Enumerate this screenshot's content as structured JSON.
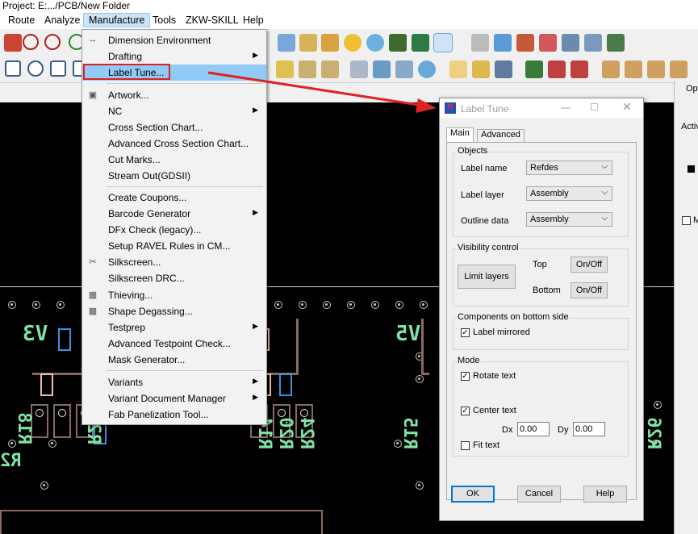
{
  "app": {
    "title": "Project: E:.../PCB/New Folder",
    "menubar": [
      "Route",
      "Analyze",
      "Manufacture",
      "Tools",
      "ZKW-SKILL",
      "Help"
    ],
    "active_menu": "Manufacture"
  },
  "manufacture_menu": {
    "items": [
      {
        "label": "Dimension Environment",
        "icon": "dimension-icon",
        "submenu": false
      },
      {
        "label": "Drafting",
        "icon": "",
        "submenu": true
      },
      {
        "label": "Label Tune...",
        "icon": "",
        "submenu": false,
        "highlighted": true
      },
      {
        "label": "Artwork...",
        "icon": "artwork-icon",
        "submenu": false
      },
      {
        "label": "NC",
        "icon": "",
        "submenu": true
      },
      {
        "label": "Cross Section Chart...",
        "icon": "",
        "submenu": false
      },
      {
        "label": "Advanced Cross Section Chart...",
        "icon": "",
        "submenu": false
      },
      {
        "label": "Cut Marks...",
        "icon": "",
        "submenu": false
      },
      {
        "label": "Stream Out(GDSII)",
        "icon": "",
        "submenu": false
      },
      {
        "label": "Create Coupons...",
        "icon": "",
        "submenu": false
      },
      {
        "label": "Barcode Generator",
        "icon": "",
        "submenu": true
      },
      {
        "label": "DFx Check (legacy)...",
        "icon": "",
        "submenu": false
      },
      {
        "label": "Setup RAVEL Rules in CM...",
        "icon": "",
        "submenu": false
      },
      {
        "label": "Silkscreen...",
        "icon": "silkscreen-icon",
        "submenu": false
      },
      {
        "label": "Silkscreen DRC...",
        "icon": "",
        "submenu": false
      },
      {
        "label": "Thieving...",
        "icon": "thieving-icon",
        "submenu": false
      },
      {
        "label": "Shape Degassing...",
        "icon": "degassing-icon",
        "submenu": false
      },
      {
        "label": "Testprep",
        "icon": "",
        "submenu": true
      },
      {
        "label": "Advanced Testpoint Check...",
        "icon": "",
        "submenu": false
      },
      {
        "label": "Mask Generator...",
        "icon": "",
        "submenu": false
      },
      {
        "label": "Variants",
        "icon": "",
        "submenu": true
      },
      {
        "label": "Variant Document Manager",
        "icon": "",
        "submenu": true
      },
      {
        "label": "Fab Panelization Tool...",
        "icon": "",
        "submenu": false
      }
    ]
  },
  "dialog": {
    "title": "Label Tune",
    "tabs": [
      "Main",
      "Advanced"
    ],
    "objects": {
      "group": "Objects",
      "label_name_label": "Label name",
      "label_name_value": "Refdes",
      "label_layer_label": "Label layer",
      "label_layer_value": "Assembly",
      "outline_data_label": "Outline data",
      "outline_data_value": "Assembly"
    },
    "visibility": {
      "group": "Visibility control",
      "limit_layers": "Limit layers",
      "top_label": "Top",
      "top_button": "On/Off",
      "bottom_label": "Bottom",
      "bottom_button": "On/Off"
    },
    "bottom_side": {
      "group": "Components on bottom side",
      "label_mirrored": "Label mirrored",
      "label_mirrored_checked": true
    },
    "mode": {
      "group": "Mode",
      "rotate_text": "Rotate text",
      "rotate_text_checked": true,
      "center_text": "Center text",
      "center_text_checked": true,
      "dx_label": "Dx",
      "dx_value": "0.00",
      "dy_label": "Dy",
      "dy_value": "0.00",
      "fit_text": "Fit text",
      "fit_text_checked": false
    },
    "buttons": {
      "ok": "OK",
      "cancel": "Cancel",
      "help": "Help"
    }
  },
  "right_panel": {
    "header": "Opt",
    "label": "Activ",
    "checkbox_label": "M"
  },
  "canvas_labels": [
    "V3",
    "V5",
    "R18",
    "R28",
    "R23",
    "R14",
    "R20",
    "R24",
    "R15",
    "R26",
    "R2"
  ],
  "colors": {
    "highlight_box": "#e02020",
    "arrow": "#e02020",
    "silk_text": "#7fe3a4",
    "menu_highlight": "#91c9f7"
  }
}
